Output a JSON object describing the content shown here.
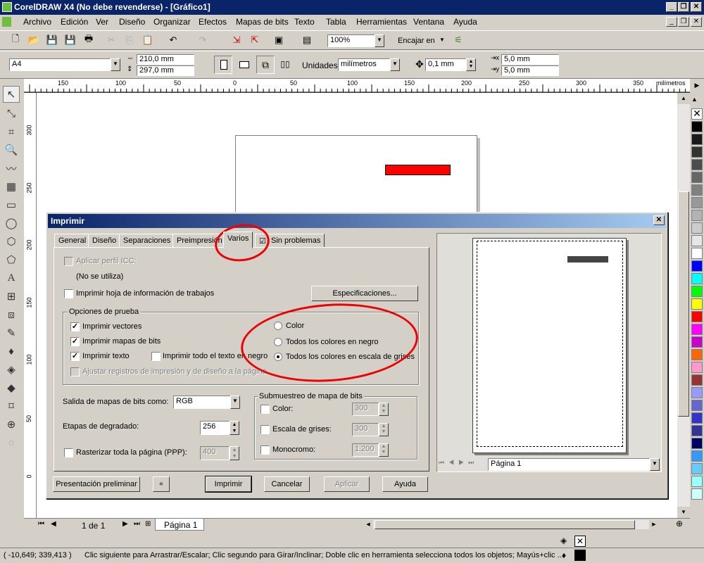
{
  "app": {
    "title": "CorelDRAW X4 (No debe revenderse) - [Gráfico1]",
    "menu": [
      "Archivo",
      "Edición",
      "Ver",
      "Diseño",
      "Organizar",
      "Efectos",
      "Mapas de bits",
      "Texto",
      "Tabla",
      "Herramientas",
      "Ventana",
      "Ayuda"
    ]
  },
  "toolbar": {
    "zoom": "100%",
    "snap_label": "Encajar en"
  },
  "property_bar": {
    "paper": "A4",
    "width": "210,0 mm",
    "height": "297,0 mm",
    "units_label": "Unidades:",
    "units": "milímetros",
    "nudge": "0,1 mm",
    "dup_x": "5,0 mm",
    "dup_y": "5,0 mm"
  },
  "ruler": {
    "top_ticks": [
      "150",
      "100",
      "150",
      "200",
      "250",
      "300",
      "350"
    ],
    "top_ticks_mid": [
      "100",
      "50",
      "0",
      "50",
      "100"
    ],
    "unit": "milímetros",
    "left_ticks": [
      "300",
      "250",
      "200",
      "150",
      "100",
      "50",
      "0"
    ],
    "left_unit": "milímetros"
  },
  "page_nav": {
    "counter": "1 de 1",
    "page_tab": "Página 1"
  },
  "status": {
    "coords": "( -10,649; 339,413 )",
    "hint": "Clic siguiente para Arrastrar/Escalar; Clic segundo para Girar/Inclinar; Doble clic en herramienta selecciona todos los objetos; Mayús+clic ..."
  },
  "dialog": {
    "title": "Imprimir",
    "tabs": [
      "General",
      "Diseño",
      "Separaciones",
      "Preimpresión",
      "Varios",
      "Sin problemas"
    ],
    "active_tab": "Varios",
    "icc_label": "Aplicar perfil ICC:",
    "icc_value": "(No se utiliza)",
    "job_info_label": "Imprimir hoja de información de trabajos",
    "specs_button": "Especificaciones...",
    "proof_group": "Opciones de prueba",
    "print_vectors": "Imprimir vectores",
    "print_bitmaps": "Imprimir mapas de bits",
    "print_text": "Imprimir texto",
    "print_all_text_black": "Imprimir todo el texto en negro",
    "fit_marks": "Ajustar registros de impresión y de diseño a la página",
    "radio_color": "Color",
    "radio_black": "Todos los colores en negro",
    "radio_gray": "Todos los colores en escala de grises",
    "bitmap_output_label": "Salida de mapas de bits como:",
    "bitmap_output_value": "RGB",
    "fountain_steps_label": "Etapas de degradado:",
    "fountain_steps_value": "256",
    "rasterize_label": "Rasterizar toda la página (PPP):",
    "rasterize_value": "400",
    "downsample_group": "Submuestreo de mapa de bits",
    "ds_color": "Color:",
    "ds_color_value": "300",
    "ds_gray": "Escala de grises:",
    "ds_gray_value": "300",
    "ds_mono": "Monocromo:",
    "ds_mono_value": "1.200",
    "preview_page": "Página 1",
    "btn_preview": "Presentación preliminar",
    "btn_print": "Imprimir",
    "btn_cancel": "Cancelar",
    "btn_apply": "Aplicar",
    "btn_help": "Ayuda"
  },
  "colors": {
    "title_bar": "#0a246a",
    "annotation_red": "#ee0000",
    "rect_fill": "#ff0000"
  },
  "palette": [
    "#000000",
    "#1a1a1a",
    "#333333",
    "#4d4d4d",
    "#666666",
    "#808080",
    "#999999",
    "#b3b3b3",
    "#cccccc",
    "#e6e6e6",
    "#ffffff",
    "#0000ff",
    "#00ffff",
    "#00ff00",
    "#ffff00",
    "#ff0000",
    "#ff00ff",
    "#cc00cc",
    "#ff6600",
    "#ff99cc",
    "#993333",
    "#9999ff",
    "#6666cc",
    "#3333cc",
    "#333399",
    "#000066",
    "#3399ff",
    "#66ccff",
    "#99ffff",
    "#ccffff"
  ]
}
